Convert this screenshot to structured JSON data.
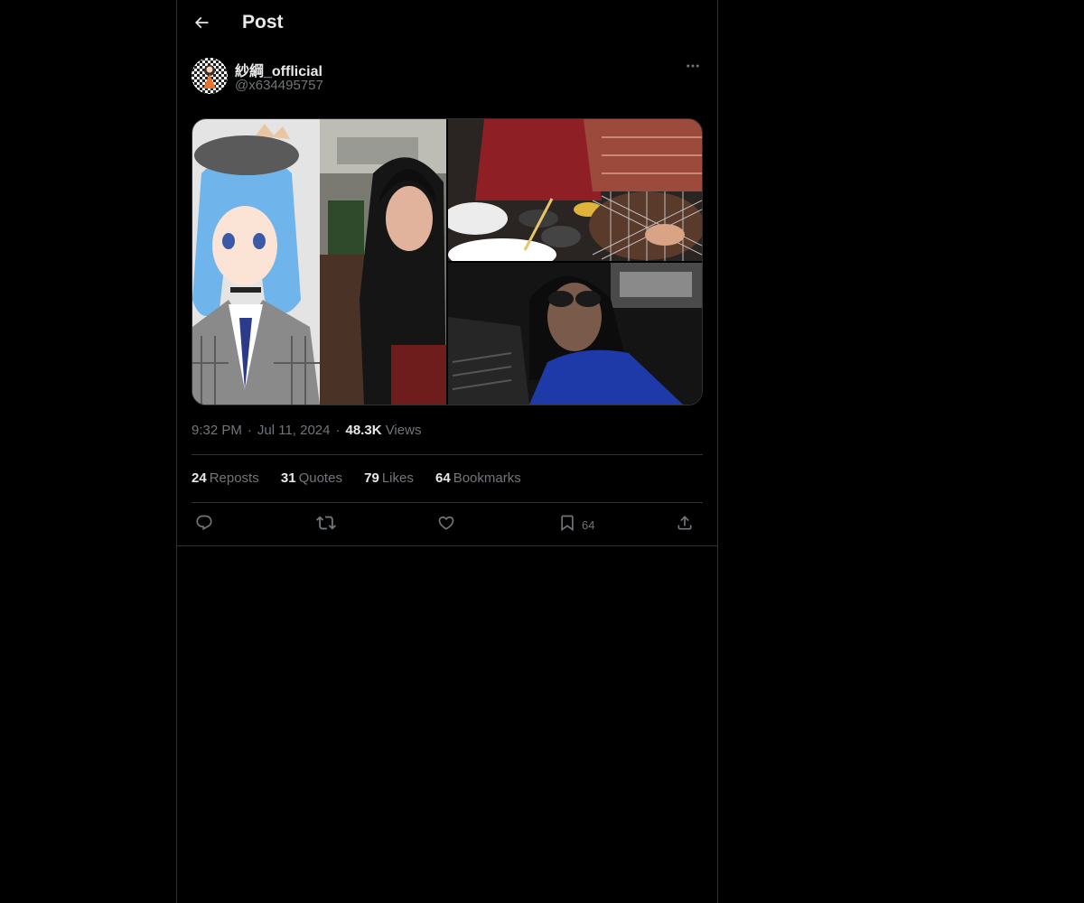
{
  "header": {
    "title": "Post",
    "back_icon": "arrow-left-icon"
  },
  "author": {
    "display_name": "紗綱_offlicial",
    "handle": "@x634495757",
    "more_icon": "more-horizontal-icon"
  },
  "media": {
    "count": 3
  },
  "meta": {
    "time": "9:32 PM",
    "date": "Jul 11, 2024",
    "views_count": "48.3K",
    "views_label": "Views"
  },
  "stats": [
    {
      "count": "24",
      "label": "Reposts"
    },
    {
      "count": "31",
      "label": "Quotes"
    },
    {
      "count": "79",
      "label": "Likes"
    },
    {
      "count": "64",
      "label": "Bookmarks"
    }
  ],
  "actions": {
    "reply_icon": "reply-icon",
    "repost_icon": "repost-icon",
    "like_icon": "heart-icon",
    "bookmark_icon": "bookmark-icon",
    "bookmark_count": "64",
    "share_icon": "share-icon"
  },
  "colors": {
    "background": "#000000",
    "text_primary": "#e7e9ea",
    "text_secondary": "#71767b",
    "border": "#2f3336"
  }
}
